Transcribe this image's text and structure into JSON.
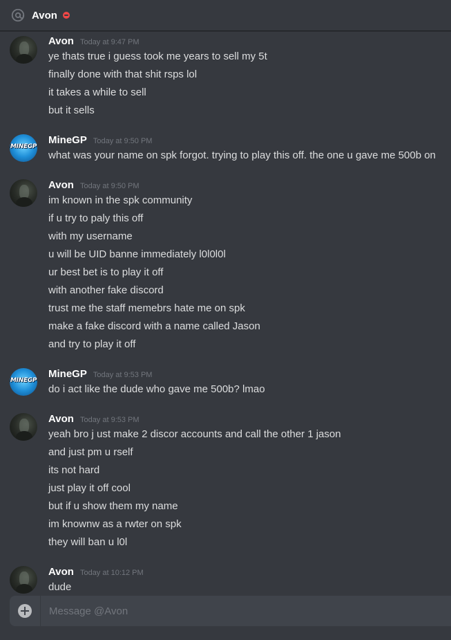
{
  "header": {
    "title": "Avon",
    "status": "dnd",
    "status_color": "#f04747"
  },
  "composer": {
    "placeholder": "Message @Avon"
  },
  "colors": {
    "background": "#36393f",
    "text": "#dcddde",
    "username": "#ffffff",
    "timestamp": "#72767d",
    "dnd": "#f04747"
  },
  "groups": [
    {
      "author": "Avon",
      "time": "Today at 9:47 PM",
      "lines": [
        "ye thats true i guess took me years to sell my 5t",
        "finally done with that shit rsps lol",
        "it takes a while to sell",
        "but it sells"
      ]
    },
    {
      "author": "MineGP",
      "avatar_text": "MINEGP",
      "time": "Today at 9:50 PM",
      "lines": [
        "what was your name on spk forgot. trying to play this off. the one u gave me 500b on"
      ]
    },
    {
      "author": "Avon",
      "time": "Today at 9:50 PM",
      "lines": [
        "im known in the spk community",
        "if u try to paly this off",
        "with my username",
        "u will be UID banne immediately l0l0l0l",
        "ur best bet is to play it off",
        "with another fake discord",
        "trust me the staff memebrs hate me on spk",
        "make a fake discord with a name called Jason",
        "and try to play it off"
      ]
    },
    {
      "author": "MineGP",
      "avatar_text": "MINEGP",
      "time": "Today at 9:53 PM",
      "lines": [
        "do i act like the dude who gave me 500b? lmao"
      ]
    },
    {
      "author": "Avon",
      "time": "Today at 9:53 PM",
      "lines": [
        "yeah bro j ust make 2 discor accounts and call the other 1 jason",
        "and just pm u rself",
        "its not hard",
        "just play it off cool",
        "but if u show them my name",
        "im knownw as a rwter on spk",
        "they will ban u l0l"
      ]
    },
    {
      "author": "Avon",
      "time": "Today at 10:12 PM",
      "lines": [
        "dude"
      ]
    }
  ]
}
